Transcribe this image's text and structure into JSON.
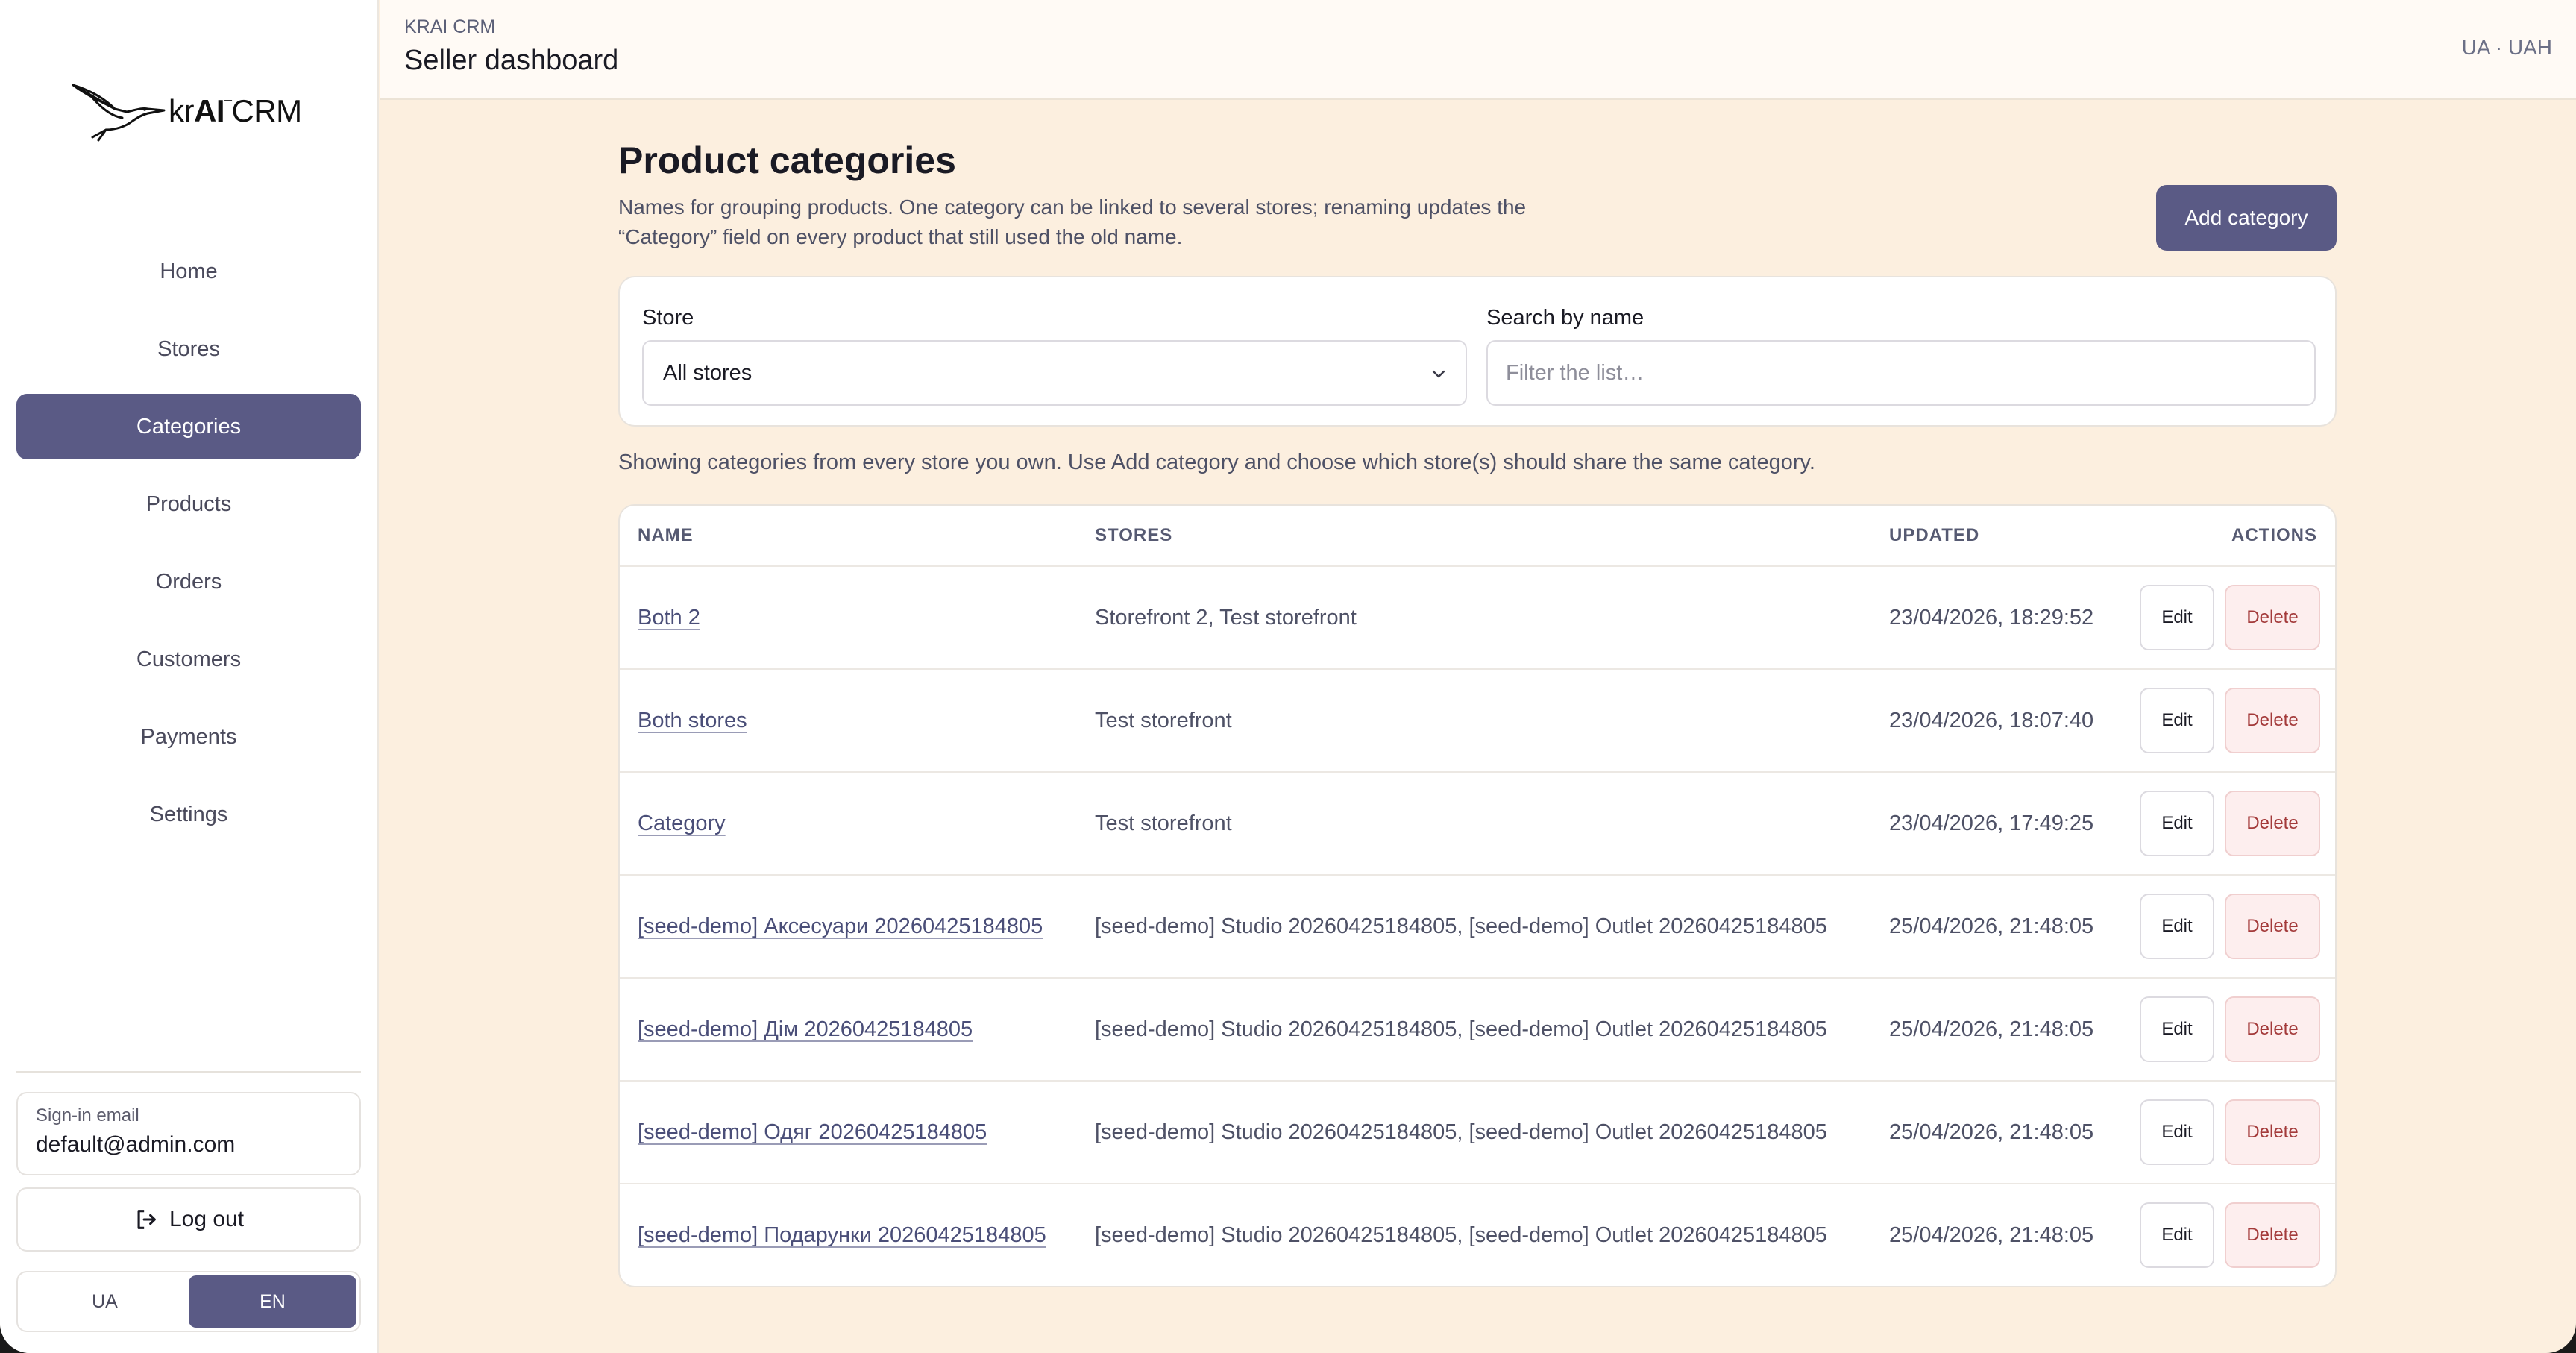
{
  "sidebar": {
    "logo": {
      "text_prefix": "kr",
      "text_bold": "AI",
      "text_suffix": "CRM",
      "icon": "crane-bird-icon"
    },
    "nav": [
      {
        "label": "Home",
        "active": false
      },
      {
        "label": "Stores",
        "active": false
      },
      {
        "label": "Categories",
        "active": true
      },
      {
        "label": "Products",
        "active": false
      },
      {
        "label": "Orders",
        "active": false
      },
      {
        "label": "Customers",
        "active": false
      },
      {
        "label": "Payments",
        "active": false
      },
      {
        "label": "Settings",
        "active": false
      }
    ],
    "signin_label": "Sign-in email",
    "signin_email": "default@admin.com",
    "logout_label": "Log out",
    "languages": [
      {
        "label": "UA",
        "active": false
      },
      {
        "label": "EN",
        "active": true
      }
    ]
  },
  "topbar": {
    "brand": "KRAI CRM",
    "title": "Seller dashboard",
    "locale": "UA · UAH"
  },
  "page": {
    "title": "Product categories",
    "subtitle": "Names for grouping products. One category can be linked to several stores; renaming updates the “Category” field on every product that still used the old name.",
    "add_button": "Add category",
    "filters": {
      "store_label": "Store",
      "store_value": "All stores",
      "search_label": "Search by name",
      "search_placeholder": "Filter the list…",
      "search_value": ""
    },
    "info": "Showing categories from every store you own. Use Add category and choose which store(s) should share the same category."
  },
  "table": {
    "columns": [
      "NAME",
      "STORES",
      "UPDATED",
      "ACTIONS"
    ],
    "edit_label": "Edit",
    "delete_label": "Delete",
    "rows": [
      {
        "name": "Both 2",
        "stores": "Storefront 2, Test storefront",
        "updated": "23/04/2026, 18:29:52"
      },
      {
        "name": "Both stores",
        "stores": "Test storefront",
        "updated": "23/04/2026, 18:07:40"
      },
      {
        "name": "Category",
        "stores": "Test storefront",
        "updated": "23/04/2026, 17:49:25"
      },
      {
        "name": "[seed-demo] Аксесуари 20260425184805",
        "stores": "[seed-demo] Studio 20260425184805, [seed-demo] Outlet 20260425184805",
        "updated": "25/04/2026, 21:48:05"
      },
      {
        "name": "[seed-demo] Дім 20260425184805",
        "stores": "[seed-demo] Studio 20260425184805, [seed-demo] Outlet 20260425184805",
        "updated": "25/04/2026, 21:48:05"
      },
      {
        "name": "[seed-demo] Одяг 20260425184805",
        "stores": "[seed-demo] Studio 20260425184805, [seed-demo] Outlet 20260425184805",
        "updated": "25/04/2026, 21:48:05"
      },
      {
        "name": "[seed-demo] Подарунки 20260425184805",
        "stores": "[seed-demo] Studio 20260425184805, [seed-demo] Outlet 20260425184805",
        "updated": "25/04/2026, 21:48:05"
      }
    ]
  },
  "colors": {
    "accent": "#5a5a85",
    "page_bg": "#fcefdf",
    "delete_text": "#a33a3a",
    "delete_bg": "#fdeeee"
  }
}
